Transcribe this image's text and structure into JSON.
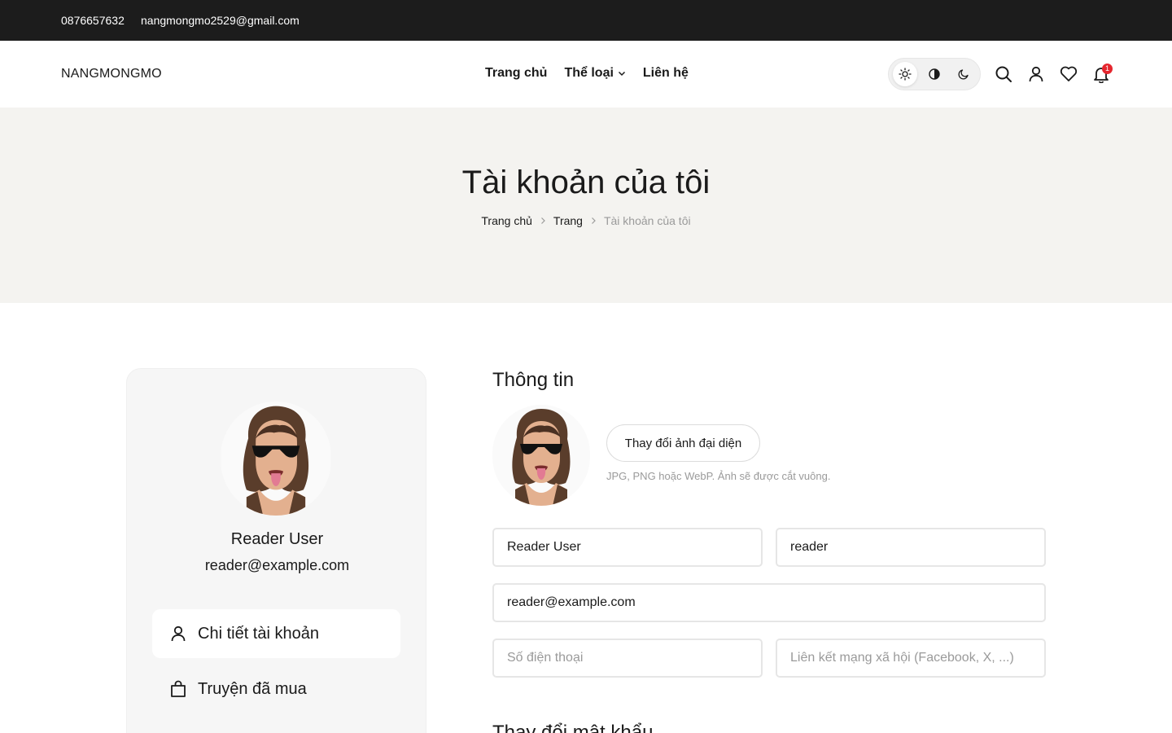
{
  "topbar": {
    "phone": "0876657632",
    "email": "nangmongmo2529@gmail.com"
  },
  "header": {
    "logo": "NANGMONGMO",
    "nav": [
      {
        "label": "Trang chủ"
      },
      {
        "label": "Thể loại"
      },
      {
        "label": "Liên hệ"
      }
    ],
    "theme_modes": [
      "light-icon",
      "contrast-icon",
      "moon-icon"
    ],
    "icons": [
      "search-icon",
      "user-icon",
      "heart-icon",
      "bell-icon"
    ],
    "notification_count": "1"
  },
  "hero": {
    "title": "Tài khoản của tôi",
    "breadcrumb": [
      "Trang chủ",
      "Trang",
      "Tài khoản của tôi"
    ]
  },
  "sidebar": {
    "name": "Reader User",
    "email": "reader@example.com",
    "menu": [
      {
        "label": "Chi tiết tài khoản",
        "icon": "user-icon",
        "active": true
      },
      {
        "label": "Truyện đã mua",
        "icon": "shopping-bag-icon",
        "active": false
      }
    ]
  },
  "profile": {
    "section_title": "Thông tin",
    "change_avatar_label": "Thay đổi ảnh đại diện",
    "avatar_hint": "JPG, PNG hoặc WebP. Ảnh sẽ được cắt vuông.",
    "fields": {
      "full_name": {
        "value": "Reader User",
        "placeholder": ""
      },
      "username": {
        "value": "reader",
        "placeholder": ""
      },
      "email": {
        "value": "reader@example.com",
        "placeholder": ""
      },
      "phone": {
        "value": "",
        "placeholder": "Số điện thoại"
      },
      "social": {
        "value": "",
        "placeholder": "Liên kết mạng xã hội (Facebook, X, ...)"
      }
    },
    "next_section_title": "Thay đổi mật khẩu"
  },
  "colors": {
    "topbar": "#1c1c1c",
    "hero_bg": "#f4f3f0",
    "badge": "#e5262e",
    "sidebar_bg": "#f6f6f6"
  }
}
